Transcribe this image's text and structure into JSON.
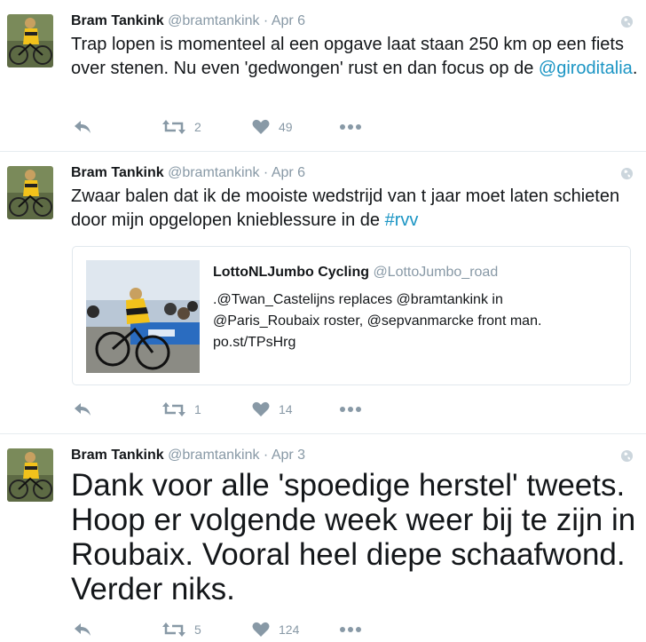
{
  "tweets": [
    {
      "name": "Bram Tankink",
      "handle": "@bramtankink",
      "separator": "·",
      "time": "Apr 6",
      "text_parts": [
        "Trap lopen is momenteel al een opgave laat staan 250 km op een fiets over stenen. Nu even 'gedwongen' rust en dan focus op de ",
        "@giroditalia",
        "."
      ],
      "retweets": "2",
      "likes": "49"
    },
    {
      "name": "Bram Tankink",
      "handle": "@bramtankink",
      "separator": "·",
      "time": "Apr 6",
      "text_parts": [
        "Zwaar balen dat ik de mooiste wedstrijd van t jaar moet laten schieten door mijn opgelopen knieblessure in de ",
        "#rvv",
        ""
      ],
      "quote": {
        "name": "LottoNLJumbo Cycling",
        "handle": "@LottoJumbo_road",
        "lines": [
          ".@Twan_Castelijns replaces @bramtankink in",
          "@Paris_Roubaix roster, @sepvanmarcke front man.",
          "po.st/TPsHrg"
        ]
      },
      "retweets": "1",
      "likes": "14"
    },
    {
      "name": "Bram Tankink",
      "handle": "@bramtankink",
      "separator": "·",
      "time": "Apr 3",
      "text_parts": [
        "Dank voor alle 'spoedige herstel' tweets. Hoop er volgende week weer bij te zijn in Roubaix. Vooral heel diepe schaafwond. Verder niks.",
        "",
        ""
      ],
      "retweets": "5",
      "likes": "124"
    }
  ],
  "icons": {
    "reply": "reply-icon",
    "retweet": "retweet-icon",
    "like": "heart-icon",
    "more": "more-dots-icon",
    "globe": "globe-icon"
  },
  "colors": {
    "link": "#1b95c4",
    "muted": "#8899a6",
    "text": "#14171a",
    "border": "#e6ecf0"
  }
}
